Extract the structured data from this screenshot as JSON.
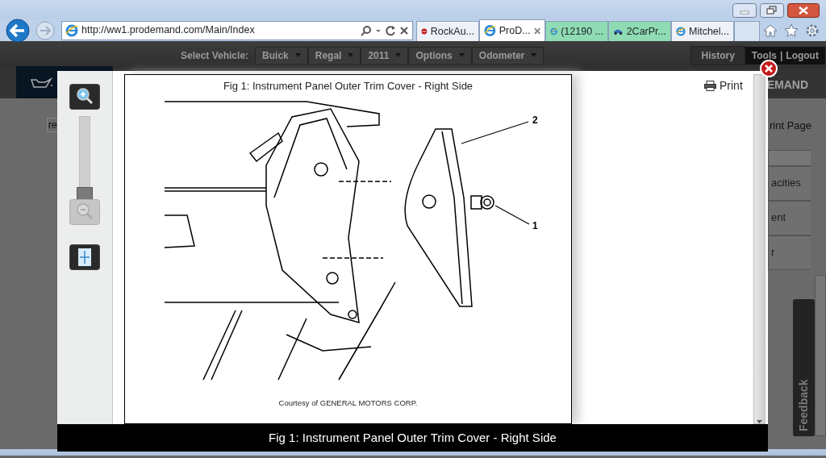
{
  "browser": {
    "address": "http://ww1.prodemand.com/Main/Index",
    "tabs": [
      {
        "label": "RockAu...",
        "selected": false,
        "color": "#eef2f8"
      },
      {
        "label": "ProD...",
        "selected": true,
        "color": "#ffffff"
      },
      {
        "label": "(12190 ...",
        "selected": false,
        "color": "#8fdcb4"
      },
      {
        "label": "2CarPr...",
        "selected": false,
        "color": "#8fdcb4"
      },
      {
        "label": "Mitchel...",
        "selected": false,
        "color": "#eef2f8"
      }
    ]
  },
  "site_header": {
    "select_label": "Select Vehicle:",
    "selectors": [
      "Buick",
      "Regal",
      "2011",
      "Options",
      "Odometer"
    ],
    "history": "History",
    "links": [
      "Tools",
      "Logout"
    ],
    "separator": "|"
  },
  "background_page": {
    "search_value": "re",
    "brand_fragment": "EMAND",
    "print_page_fragment": "rint Page",
    "menu_items": [
      "acities",
      "ent",
      "r"
    ],
    "feedback": "Feedback"
  },
  "viewer": {
    "zoom": {
      "level": 0,
      "zoom_out_disabled": true
    },
    "print": "Print",
    "figure_title": "Fig 1: Instrument Panel Outer Trim Cover - Right Side",
    "callouts": [
      "2",
      "1"
    ],
    "courtesy": "Courtesy of GENERAL MOTORS CORP.",
    "caption": "Fig 1: Instrument Panel Outer Trim Cover - Right Side"
  }
}
